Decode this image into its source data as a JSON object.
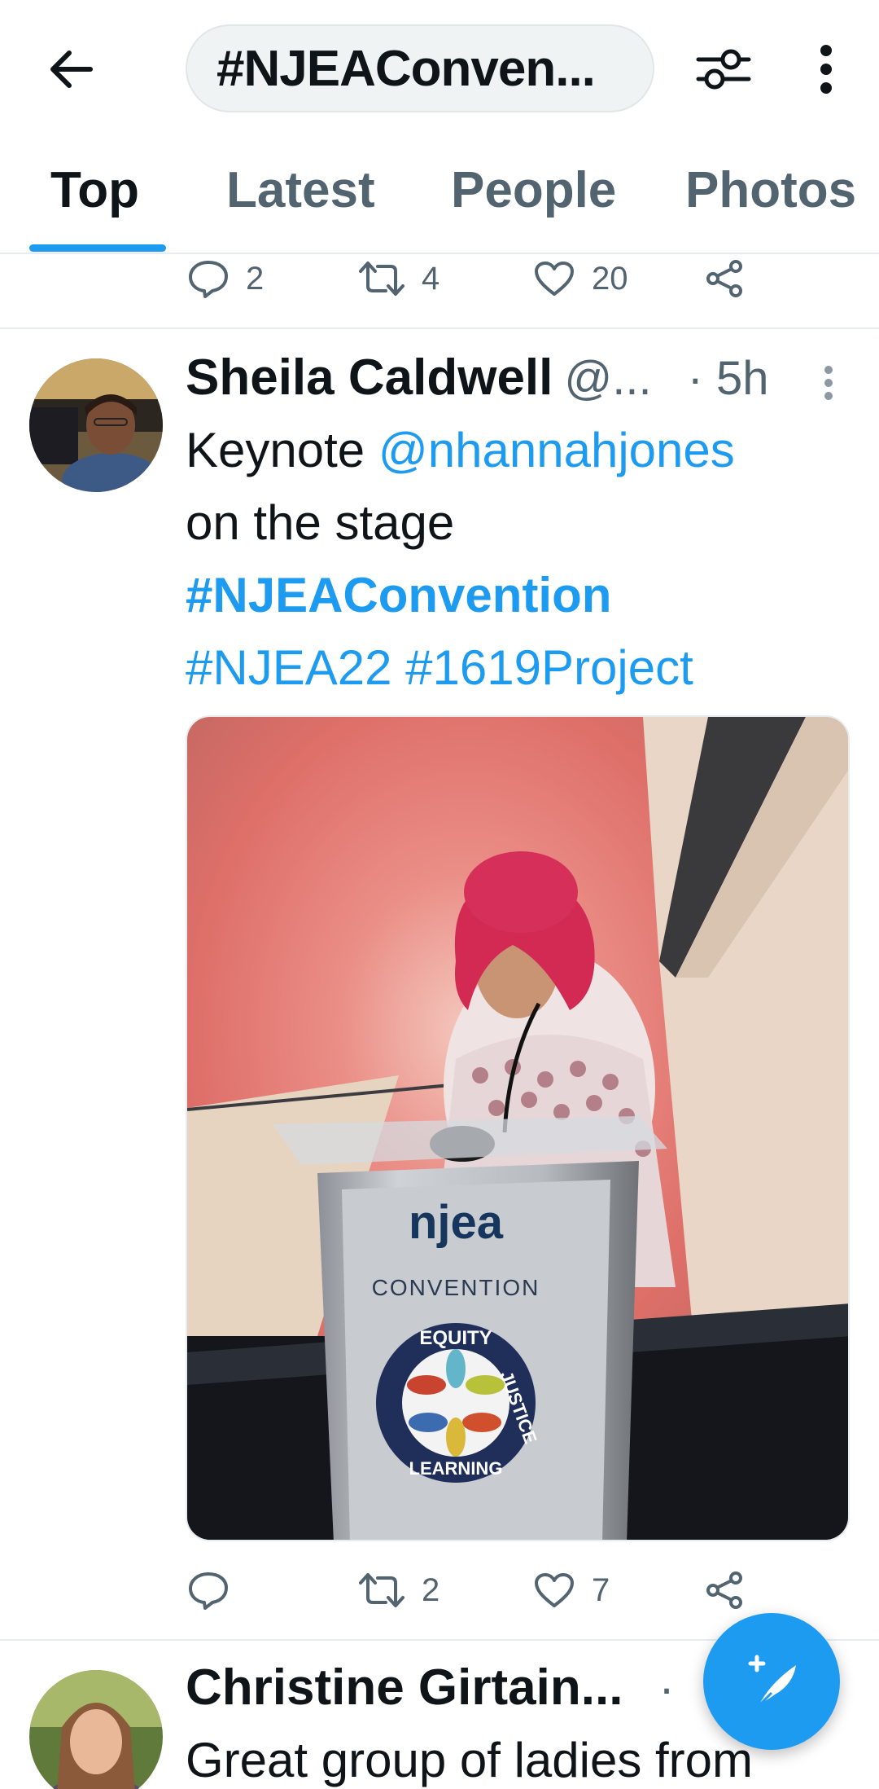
{
  "header": {
    "search_query": "#NJEAConven...",
    "back_icon": "arrow-left-icon",
    "filter_icon": "sliders-icon",
    "more_icon": "vertical-ellipsis-icon"
  },
  "tabs": [
    {
      "label": "Top",
      "active": true
    },
    {
      "label": "Latest",
      "active": false
    },
    {
      "label": "People",
      "active": false
    },
    {
      "label": "Photos",
      "active": false
    }
  ],
  "previous_tweet_actions": {
    "replies": "2",
    "retweets": "4",
    "likes": "20"
  },
  "tweet1": {
    "author_name": "Sheila Caldwell",
    "handle": "@...",
    "time": "· 5h",
    "text_prefix": "Keynote ",
    "mention": "@nhannahjones",
    "text_line2": "on the stage",
    "hashtag_main": "#NJEAConvention",
    "hashtag_a": "#NJEA22",
    "hashtag_b": "#1619Project",
    "media_podium": {
      "brand": "njea",
      "subtitle": "CONVENTION",
      "seal_top": "EQUITY",
      "seal_right": "JUSTICE",
      "seal_bottom": "LEARNING"
    },
    "actions": {
      "replies": "",
      "retweets": "2",
      "likes": "7"
    }
  },
  "tweet2": {
    "author_name": "Christine Girtain...",
    "time": "·",
    "text": "Great group of ladies from"
  },
  "colors": {
    "accent": "#1d9bf0",
    "text": "#0f1419",
    "muted": "#536471"
  },
  "fab_icon": "compose-feather-icon"
}
